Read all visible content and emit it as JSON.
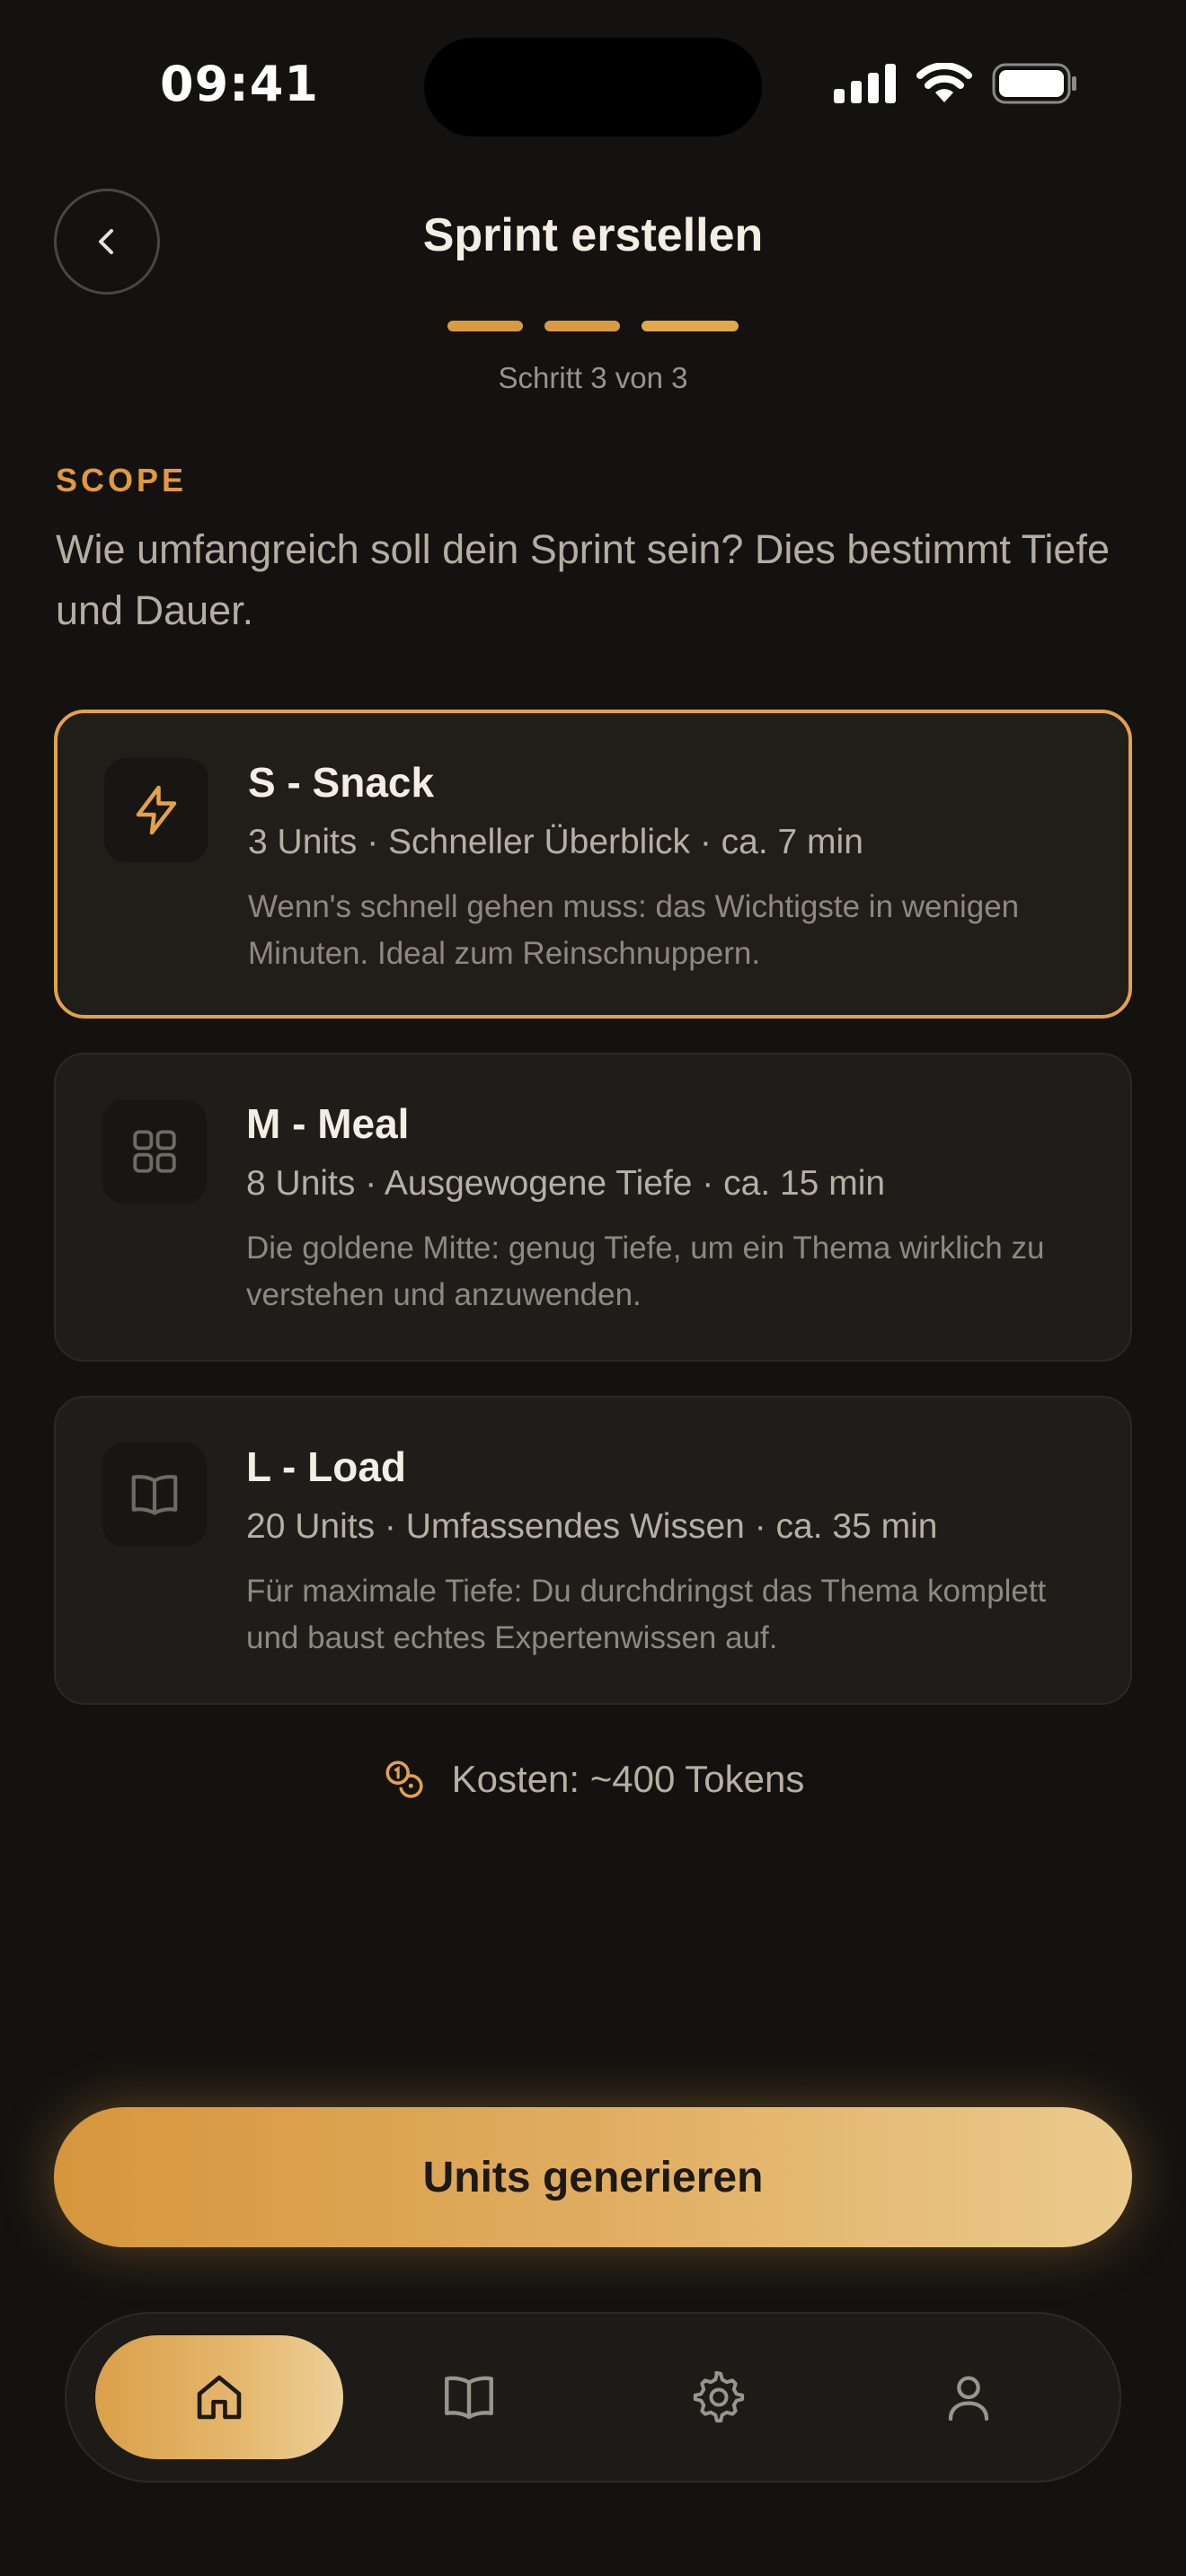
{
  "status_bar": {
    "time": "09:41"
  },
  "header": {
    "title": "Sprint erstellen",
    "step_label": "Schritt 3 von 3",
    "steps_total": 3,
    "step_current": 3
  },
  "section": {
    "label": "SCOPE",
    "description": "Wie umfangreich soll dein Sprint sein? Dies bestimmt Tiefe und Dauer."
  },
  "options": [
    {
      "icon": "lightning-icon",
      "title": "S - Snack",
      "meta": "3 Units · Schneller Überblick · ca. 7 min",
      "description": "Wenn's schnell gehen muss: das Wichtigste in wenigen Minuten. Ideal zum Reinschnuppern.",
      "selected": true
    },
    {
      "icon": "grid-icon",
      "title": "M - Meal",
      "meta": "8 Units · Ausgewogene Tiefe · ca. 15 min",
      "description": "Die goldene Mitte: genug Tiefe, um ein Thema wirklich zu verstehen und anzuwenden.",
      "selected": false
    },
    {
      "icon": "book-icon",
      "title": "L - Load",
      "meta": "20 Units · Umfassendes Wissen · ca. 35 min",
      "description": "Für maximale Tiefe: Du durchdringst das Thema komplett und baust echtes Expertenwissen auf.",
      "selected": false
    }
  ],
  "cost": {
    "icon": "coins-icon",
    "text": "Kosten: ~400 Tokens"
  },
  "cta": {
    "label": "Units generieren"
  },
  "bottom_nav": {
    "items": [
      {
        "icon": "home-icon",
        "active": true
      },
      {
        "icon": "book-icon",
        "active": false
      },
      {
        "icon": "gear-icon",
        "active": false
      },
      {
        "icon": "user-icon",
        "active": false
      }
    ]
  },
  "colors": {
    "background": "#141210",
    "accent": "#e3a24a",
    "card": "#1f1d1a",
    "text_primary": "#f3ede3",
    "text_secondary": "#b7afa3"
  }
}
